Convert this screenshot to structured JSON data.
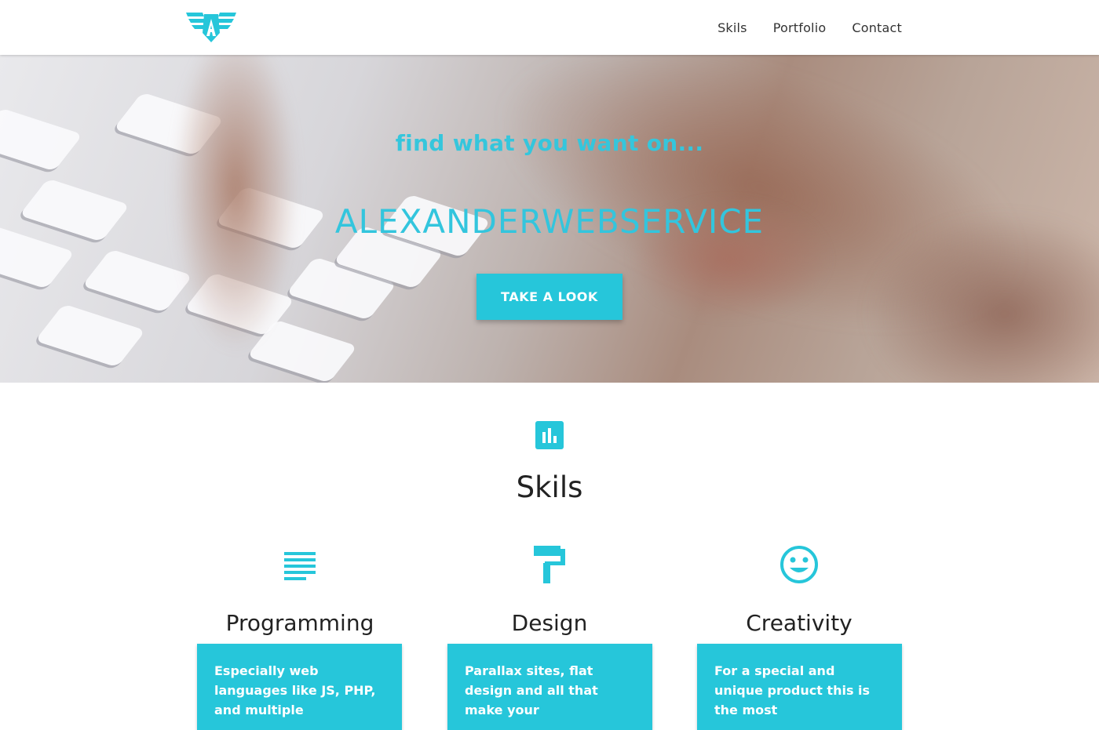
{
  "nav": {
    "logo": "alexanderwebservice-logo",
    "links": [
      "Skils",
      "Portfolio",
      "Contact"
    ]
  },
  "hero": {
    "tagline": "find what you want on...",
    "title": "ALEXANDERWEBSERVICE",
    "button_label": "TAKE A LOOK"
  },
  "skils": {
    "icon": "bar-chart-icon",
    "title": "Skils",
    "items": [
      {
        "icon": "text-lines-icon",
        "title": "Programming",
        "text": "Especially web languages like JS, PHP, and multiple"
      },
      {
        "icon": "paint-roller-icon",
        "title": "Design",
        "text": "Parallax sites, flat design and all that make your"
      },
      {
        "icon": "smiley-face-icon",
        "title": "Creativity",
        "text": "For a special and unique product this is the most"
      }
    ]
  },
  "colors": {
    "accent": "#26c6da",
    "text": "#222222"
  }
}
